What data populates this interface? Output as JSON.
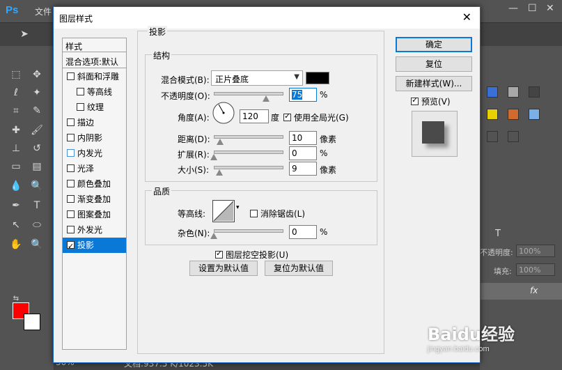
{
  "app": {
    "logo": "Ps",
    "menu_file": "文件",
    "status_zoom": "50%",
    "status_doc": "文档:937.5 K/1023.5K",
    "right_panel": {
      "opacity_label": "不透明度:",
      "opacity_value": "100%",
      "fill_label": "填充:",
      "fill_value": "100%",
      "fx_label": "fx"
    }
  },
  "watermark": {
    "brand": "Baidu经验",
    "url": "jingyan.baidu.com"
  },
  "dialog": {
    "title": "图层样式",
    "close_icon": "close-icon",
    "styles_panel": {
      "header": "样式",
      "blend_options": "混合选项:默认",
      "items": [
        {
          "label": "斜面和浮雕",
          "checked": false,
          "indent": false
        },
        {
          "label": "等高线",
          "checked": false,
          "indent": true
        },
        {
          "label": "纹理",
          "checked": false,
          "indent": true
        },
        {
          "label": "描边",
          "checked": false,
          "indent": false
        },
        {
          "label": "内阴影",
          "checked": false,
          "indent": false
        },
        {
          "label": "内发光",
          "checked": false,
          "indent": false
        },
        {
          "label": "光泽",
          "checked": false,
          "indent": false
        },
        {
          "label": "颜色叠加",
          "checked": false,
          "indent": false
        },
        {
          "label": "渐变叠加",
          "checked": false,
          "indent": false
        },
        {
          "label": "图案叠加",
          "checked": false,
          "indent": false
        },
        {
          "label": "外发光",
          "checked": false,
          "indent": false
        },
        {
          "label": "投影",
          "checked": true,
          "indent": false,
          "selected": true
        }
      ]
    },
    "drop_shadow": {
      "section_title": "投影",
      "structure_title": "结构",
      "blend_mode_label": "混合模式(B):",
      "blend_mode_value": "正片叠底",
      "shadow_color": "#000000",
      "opacity_label": "不透明度(O):",
      "opacity_value": "75",
      "opacity_unit": "%",
      "opacity_fraction": 0.75,
      "angle_label": "角度(A):",
      "angle_value": "120",
      "angle_unit": "度",
      "global_light_label": "使用全局光(G)",
      "global_light_checked": true,
      "distance_label": "距离(D):",
      "distance_value": "10",
      "distance_unit": "像素",
      "spread_label": "扩展(R):",
      "spread_value": "0",
      "spread_unit": "%",
      "size_label": "大小(S):",
      "size_value": "9",
      "size_unit": "像素",
      "quality_title": "品质",
      "contour_label": "等高线:",
      "antialias_label": "消除锯齿(L)",
      "antialias_checked": false,
      "noise_label": "杂色(N):",
      "noise_value": "0",
      "noise_unit": "%",
      "knockout_label": "图层挖空投影(U)",
      "knockout_checked": true,
      "make_default": "设置为默认值",
      "reset_default": "复位为默认值"
    },
    "buttons": {
      "ok": "确定",
      "reset": "复位",
      "new_style": "新建样式(W)...",
      "preview_label": "预览(V)",
      "preview_checked": true
    }
  }
}
